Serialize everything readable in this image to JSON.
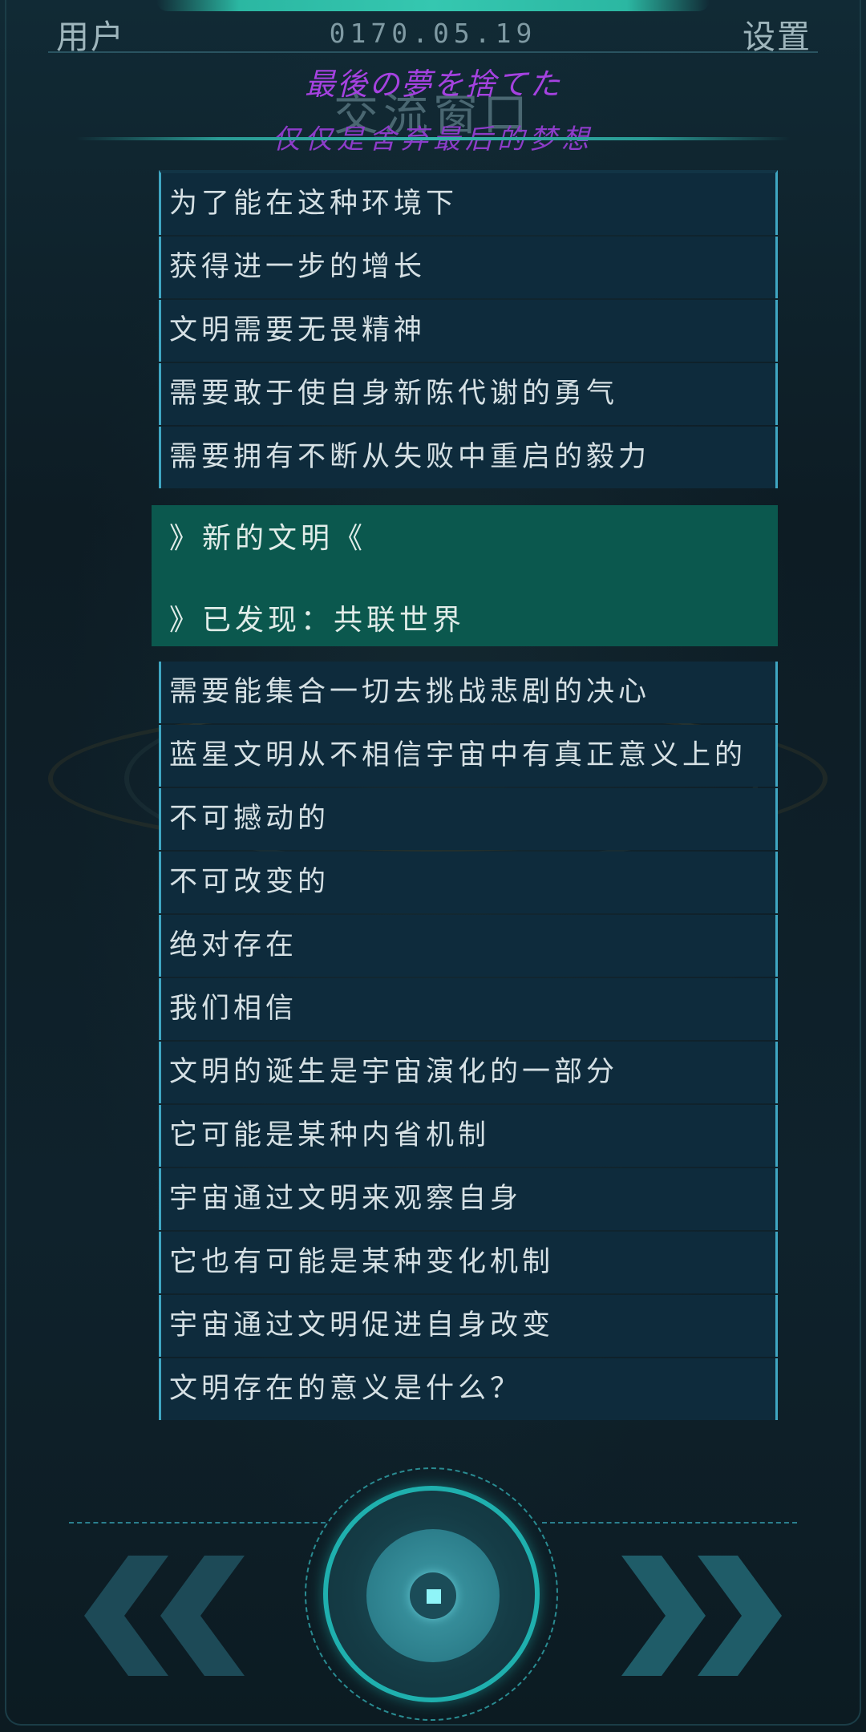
{
  "header": {
    "user_label": "用户",
    "date": "0170.05.19",
    "settings_label": "设置"
  },
  "window": {
    "title": "交流窗口",
    "lyric_jp": "最後の夢を捨てた",
    "lyric_cn": "仅仅是舍弃最后的梦想"
  },
  "messages_before": [
    "为了能在这种环境下",
    "获得进一步的增长",
    "文明需要无畏精神",
    "需要敢于使自身新陈代谢的勇气",
    "需要拥有不断从失败中重启的毅力"
  ],
  "event": {
    "line1": "》新的文明《",
    "line2": "》已发现：共联世界"
  },
  "messages_after": [
    "需要能集合一切去挑战悲剧的决心",
    "蓝星文明从不相信宇宙中有真正意义上的",
    "不可撼动的",
    "不可改变的",
    "绝对存在",
    "我们相信",
    "文明的诞生是宇宙演化的一部分",
    "它可能是某种内省机制",
    "宇宙通过文明来观察自身",
    "它也有可能是某种变化机制",
    "宇宙通过文明促进自身改变",
    "文明存在的意义是什么？"
  ],
  "controls": {
    "prev_icon": "double-chevron-left-icon",
    "next_icon": "double-chevron-right-icon",
    "center_icon": "core-button-icon",
    "accent_color": "#1fb0ae"
  }
}
